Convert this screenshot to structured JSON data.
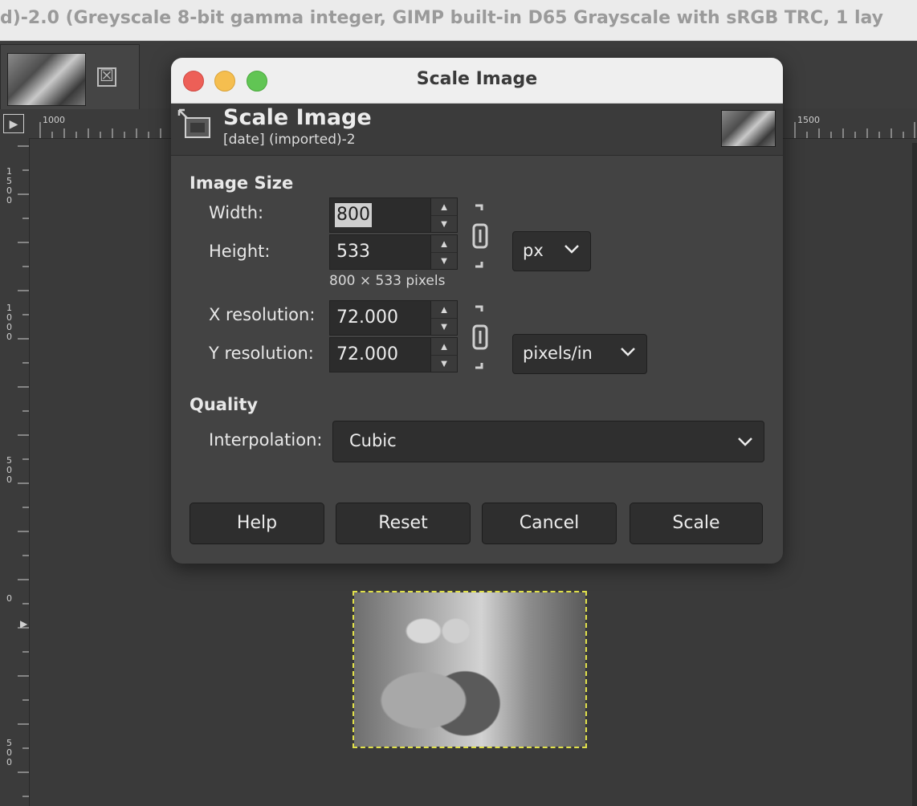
{
  "window": {
    "title": "d)-2.0 (Greyscale 8-bit gamma integer, GIMP built-in D65 Grayscale with sRGB TRC, 1 lay"
  },
  "tabs": {
    "close_glyph": "☒"
  },
  "rulers": {
    "nav_glyph": "▶",
    "h_labels": [
      "1000",
      "1500"
    ],
    "v_labels": [
      "1500",
      "1000",
      "500",
      "0",
      "500"
    ]
  },
  "dialog": {
    "window_title": "Scale Image",
    "header_title": "Scale Image",
    "header_subtitle": "[date] (imported)-2",
    "image_size_section": "Image Size",
    "width_label": "Width:",
    "width_value": "800",
    "height_label": "Height:",
    "height_value": "533",
    "size_summary": "800 × 533 pixels",
    "size_unit": "px",
    "xres_label": "X resolution:",
    "xres_value": "72.000",
    "yres_label": "Y resolution:",
    "yres_value": "72.000",
    "res_unit": "pixels/in",
    "quality_section": "Quality",
    "interpolation_label": "Interpolation:",
    "interpolation_value": "Cubic",
    "buttons": {
      "help": "Help",
      "reset": "Reset",
      "cancel": "Cancel",
      "scale": "Scale"
    }
  },
  "colors": {
    "canvas_bg": "#3b3b3b",
    "dialog_bg": "#434343",
    "selection_outline": "#e0e04a",
    "close_light": "#ed5f57",
    "minimize_light": "#f5be4f",
    "zoom_light": "#61c554"
  }
}
